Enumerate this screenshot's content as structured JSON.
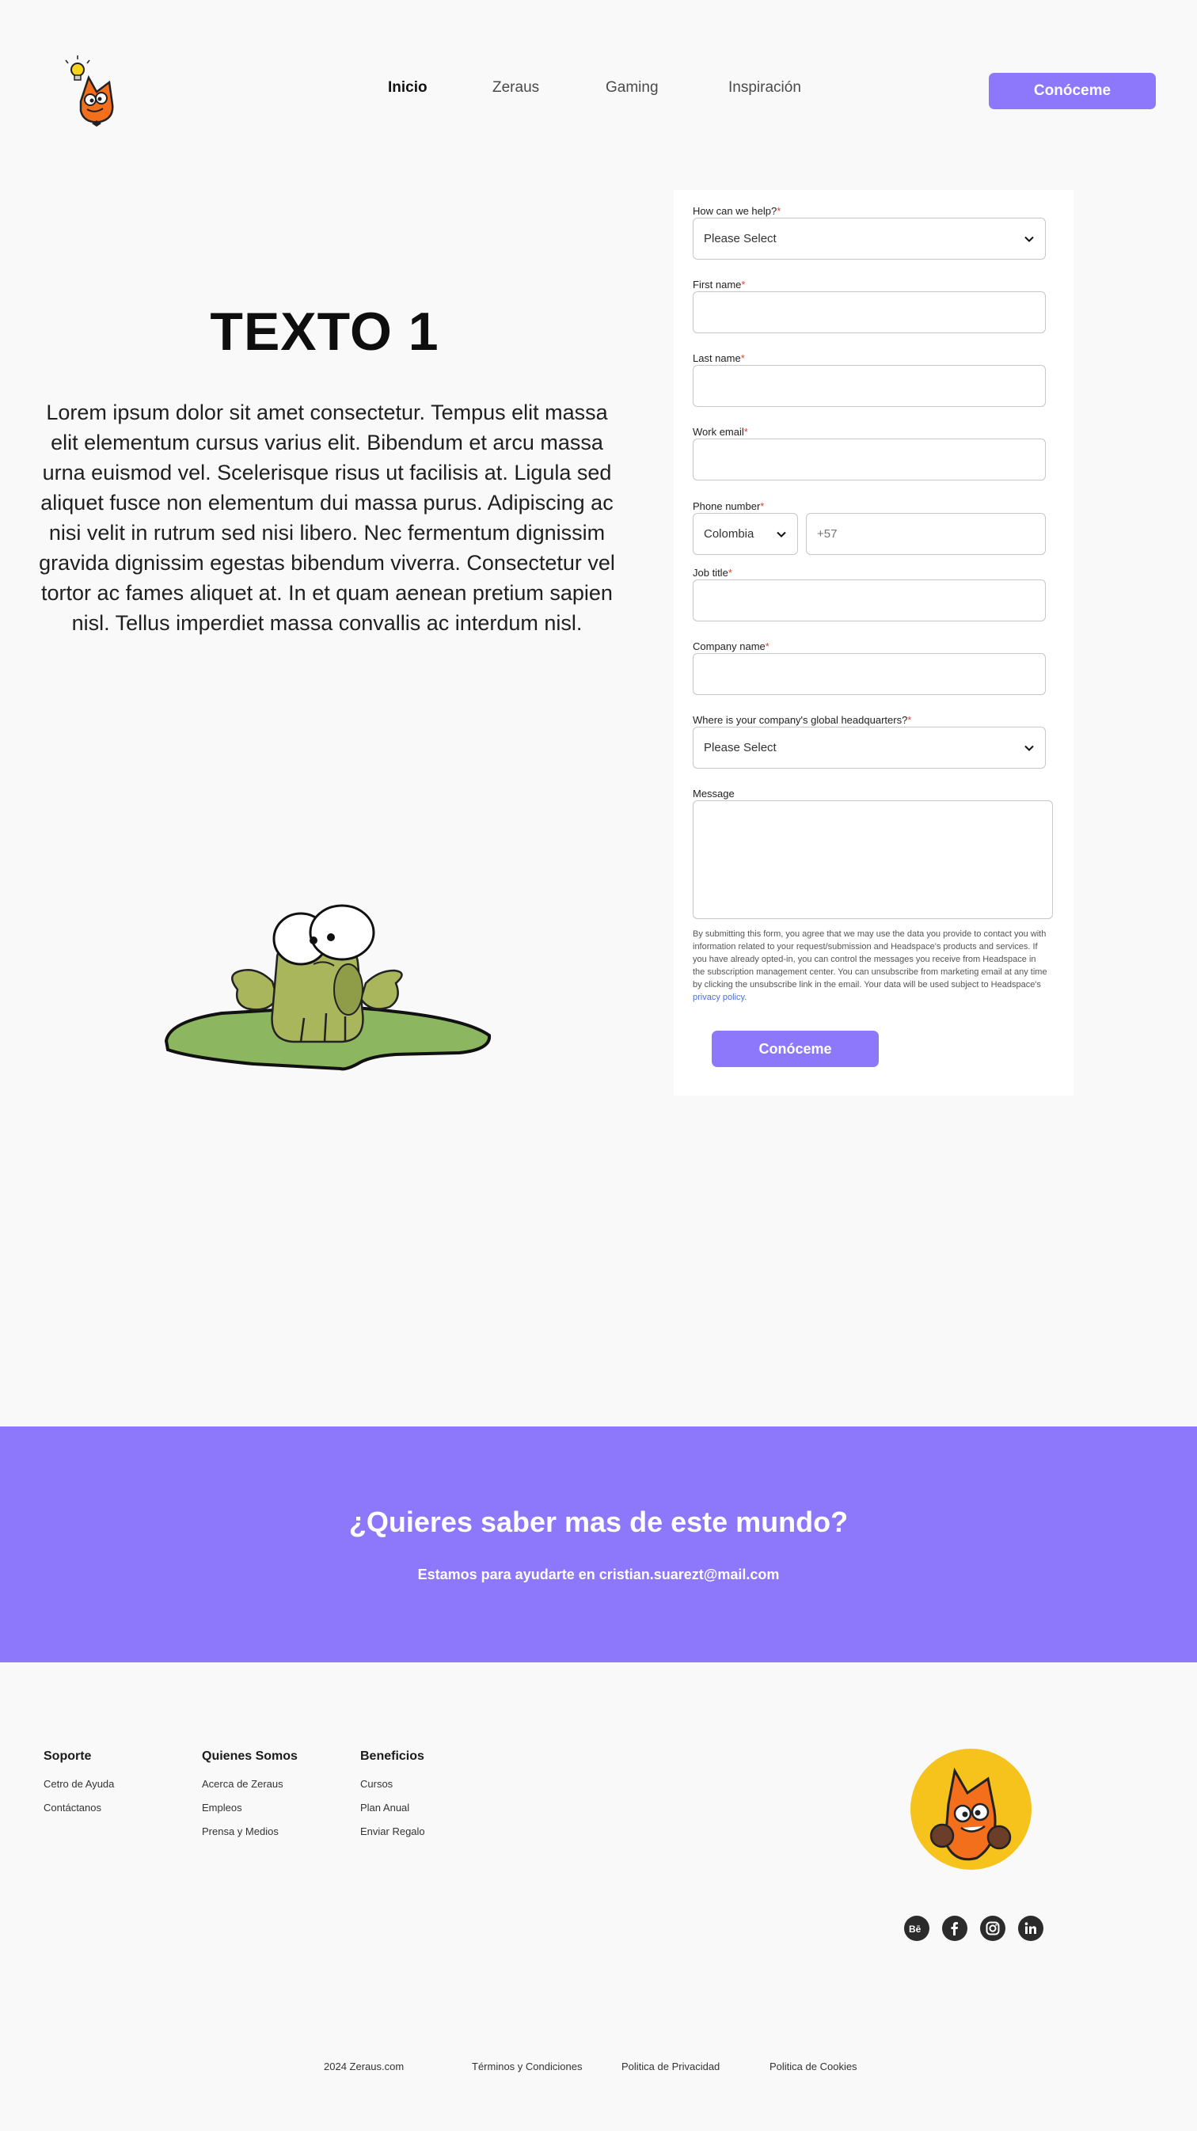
{
  "header": {
    "nav": [
      "Inicio",
      "Zeraus",
      "Gaming",
      "Inspiración"
    ],
    "cta_label": "Conóceme"
  },
  "hero": {
    "title": "TEXTO 1",
    "body": "Lorem ipsum dolor sit amet consectetur. Tempus elit massa elit elementum cursus varius elit. Bibendum et arcu massa urna euismod vel. Scelerisque risus ut facilisis at. Ligula sed aliquet fusce non elementum dui massa purus. Adipiscing ac nisi velit in rutrum sed nisi libero. Nec fermentum dignissim gravida dignissim egestas bibendum viverra. Consectetur vel tortor ac fames aliquet at. In et quam aenean pretium sapien nisl. Tellus imperdiet massa convallis ac interdum nisl."
  },
  "form": {
    "help_label": "How can we help?",
    "help_value": "Please Select",
    "first_name_label": "First name",
    "last_name_label": "Last name",
    "email_label": "Work email",
    "phone_label": "Phone number",
    "country_value": "Colombia",
    "phone_placeholder": "+57",
    "job_title_label": "Job title",
    "company_label": "Company name",
    "hq_label": "Where is your company's global headquarters?",
    "hq_value": "Please Select",
    "message_label": "Message",
    "required_mark": "*",
    "consent_text": "By submitting this form, you agree that we may use the data you provide to contact you with information related to your request/submission and Headspace's products and services. If you have already opted-in, you can control the messages you receive from Headspace in the subscription management center. You can unsubscribe from marketing email at any time by clicking the unsubscribe link in the email. Your data will be used subject to Headspace's ",
    "privacy_link": "privacy policy",
    "privacy_tail": ".",
    "submit_label": "Conóceme"
  },
  "cta": {
    "title": "¿Quieres saber mas de este mundo?",
    "subtitle": "Estamos para ayudarte en cristian.suarezt@mail.com"
  },
  "footer": {
    "columns": [
      {
        "heading": "Soporte",
        "links": [
          "Cetro de Ayuda",
          "Contáctanos"
        ]
      },
      {
        "heading": "Quienes Somos",
        "links": [
          "Acerca de Zeraus",
          "Empleos",
          "Prensa y Medios"
        ]
      },
      {
        "heading": "Beneficios",
        "links": [
          "Cursos",
          "Plan Anual",
          "Enviar Regalo"
        ]
      }
    ],
    "social": [
      "behance-icon",
      "facebook-icon",
      "instagram-icon",
      "linkedin-icon"
    ],
    "copyright": "2024 Zeraus.com",
    "legal": [
      "Términos y Condiciones",
      "Politica de Privacidad",
      "Politica de Cookies"
    ]
  },
  "colors": {
    "accent": "#8d78fb",
    "fox_orange": "#f46f1b",
    "avatar_yellow": "#f6c21c",
    "lily_green": "#8db660",
    "frog_green": "#a9b65c"
  }
}
